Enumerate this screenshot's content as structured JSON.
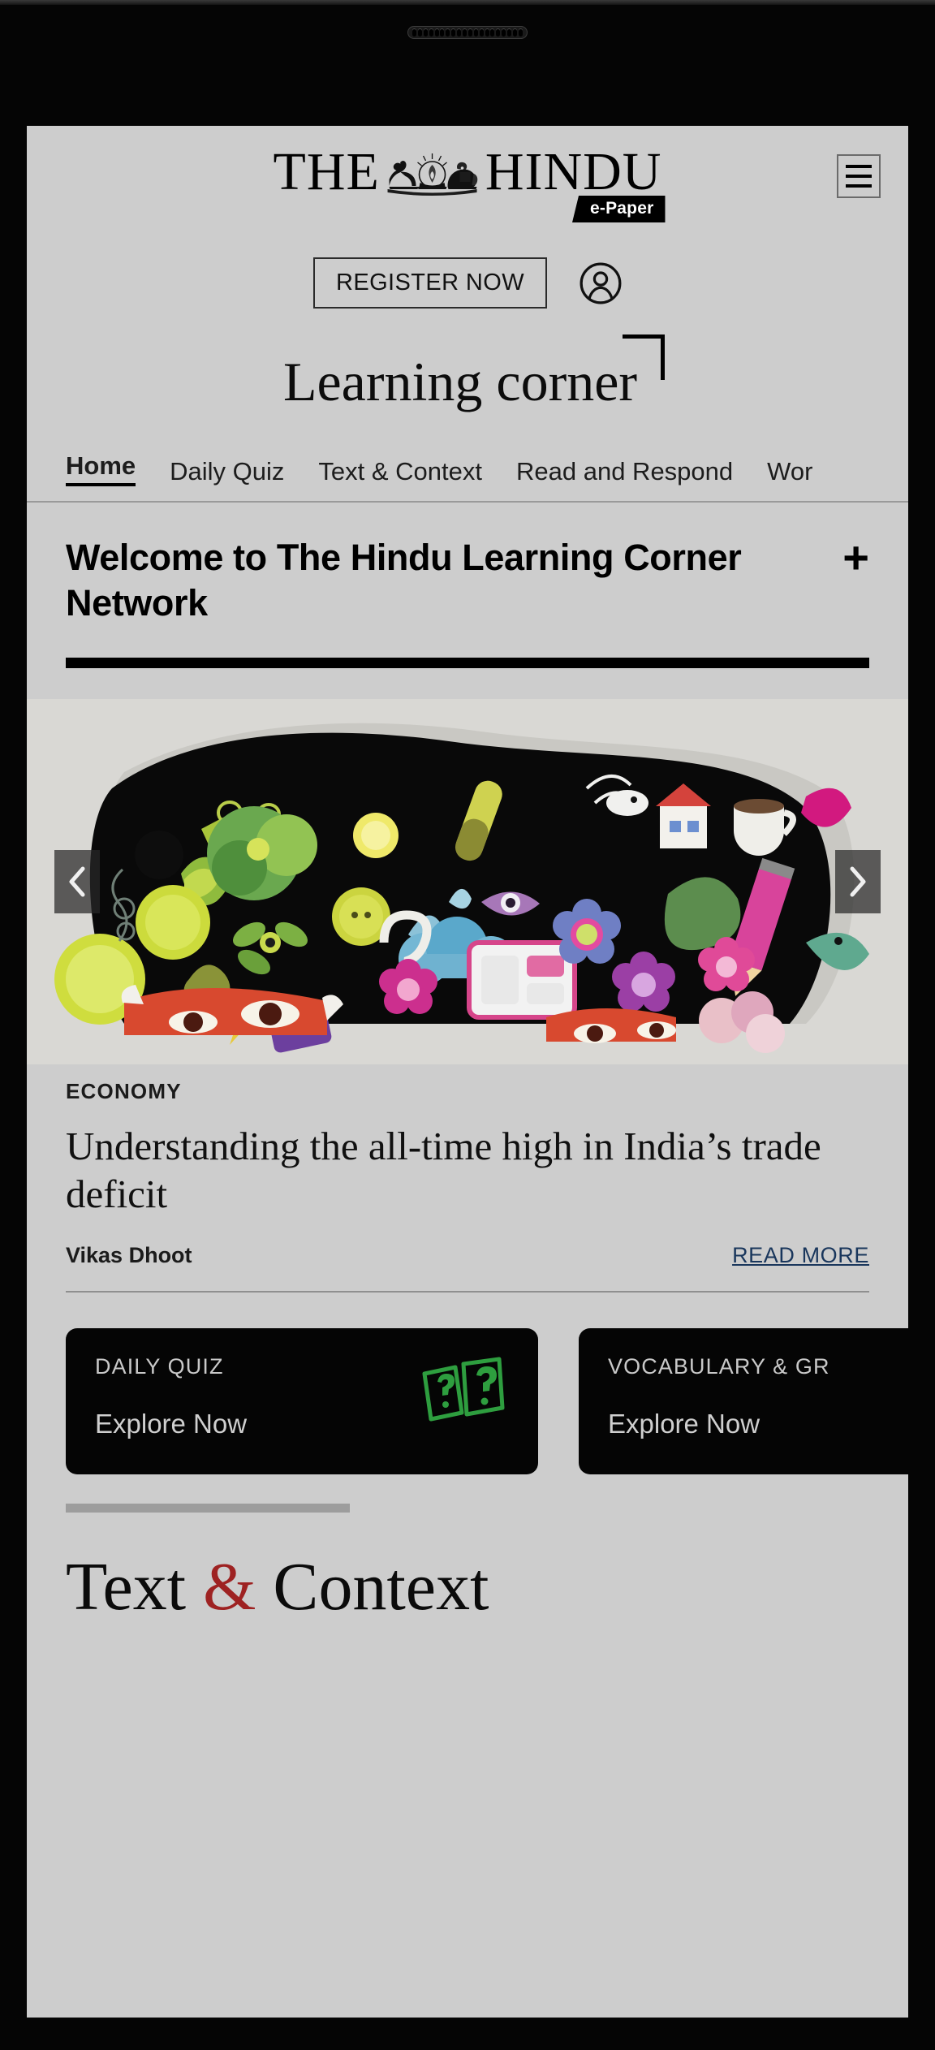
{
  "device": {
    "speaker_grille": "speaker-grille-icon"
  },
  "masthead": {
    "logo_the": "THE",
    "logo_hindu": "HINDU",
    "logo_emblem": "hindu-emblem-icon",
    "epaper_badge": "e-Paper",
    "menu_icon": "hamburger-menu-icon"
  },
  "account": {
    "register_label": "REGISTER NOW",
    "account_icon": "user-account-icon"
  },
  "section": {
    "title": "Learning corner",
    "bracket": "corner-bracket-decoration"
  },
  "nav": {
    "items": [
      {
        "label": "Home",
        "active": true
      },
      {
        "label": "Daily Quiz",
        "active": false
      },
      {
        "label": "Text & Context",
        "active": false
      },
      {
        "label": "Read and Respond",
        "active": false
      },
      {
        "label": "Wor",
        "active": false
      }
    ]
  },
  "welcome": {
    "title": "Welcome to The Hindu Learning Corner Network",
    "expand_icon": "+"
  },
  "carousel": {
    "prev_icon": "chevron-left-icon",
    "next_icon": "chevron-right-icon",
    "image_alt": "collage-illustration"
  },
  "article": {
    "kicker": "ECONOMY",
    "headline": "Understanding the all-time high in India’s trade deficit",
    "author": "Vikas Dhoot",
    "read_more": "READ MORE"
  },
  "explore": {
    "cards": [
      {
        "title": "DAILY QUIZ",
        "cta": "Explore Now",
        "icon": "quiz-cards-question-icon"
      },
      {
        "title": "VOCABULARY & GR",
        "cta": "Explore Now",
        "icon": "vocabulary-icon"
      }
    ]
  },
  "footer": {
    "logo_text": "Text ",
    "logo_amp": "&",
    "logo_text2": " Context"
  },
  "colors": {
    "page_background": "#cdcdcd",
    "card_background": "#050505",
    "accent_green": "#2e9e3f",
    "link_blue": "#19365c",
    "amp_red": "#9e2222",
    "device_black": "#050505"
  }
}
